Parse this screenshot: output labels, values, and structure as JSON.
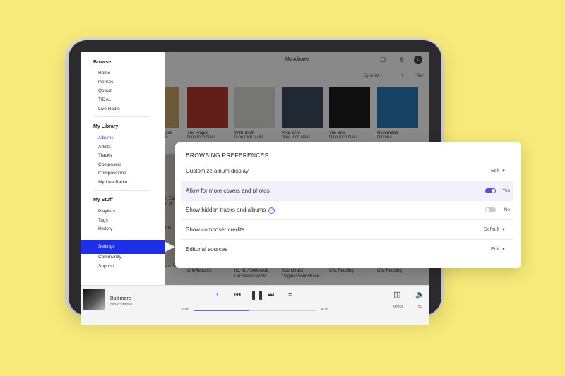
{
  "sidebar": {
    "browse_title": "Browse",
    "browse_items": [
      "Home",
      "Genres",
      "Qobuz",
      "TIDAL",
      "Live Radio"
    ],
    "library_title": "My Library",
    "library_items": [
      "Albums",
      "Artists",
      "Tracks",
      "Composers",
      "Compositions",
      "My Live Radio"
    ],
    "stuff_title": "My Stuff",
    "stuff_items": [
      "Playlists",
      "Tags",
      "History"
    ],
    "settings_label": "Settings",
    "extra_items": [
      "Community",
      "Support"
    ]
  },
  "header": {
    "title": "My Albums",
    "avatar_initial": "L",
    "sort_label": "By artist",
    "filter_label": "Filter"
  },
  "albums": [
    {
      "title": "The Fragile",
      "artist": "Nine Inch Nails",
      "color": "#b23a2a"
    },
    {
      "title": "With Teeth",
      "artist": "Nine Inch Nails",
      "color": "#d8d8d6"
    },
    {
      "title": "Year Zero",
      "artist": "Nine Inch Nails",
      "color": "#3b4c5e"
    },
    {
      "title": "The Slip",
      "artist": "Nine Inch Nails",
      "color": "#1c1c1c"
    },
    {
      "title": "Nevermind",
      "artist": "Nirvana",
      "color": "#2d78b6"
    }
  ],
  "partial_texts": {
    "left_title": "ard",
    "left_sub": "ls",
    "row2_a": "n Earl",
    "row2_b": "n W...",
    "row2_c": "me",
    "row2_d": "ger M"
  },
  "row2": [
    {
      "title": "OneRepublic",
      "artist": ""
    },
    {
      "title": "no. 40 / Serenade",
      "artist": "Orchester der W..."
    },
    {
      "title": "Soundtrack]",
      "artist": "Original Soundtrack"
    },
    {
      "title": "Otis Redding",
      "artist": ""
    },
    {
      "title": "Otis Redding",
      "artist": ""
    }
  ],
  "panel": {
    "title": "BROWSING PREFERENCES",
    "rows": [
      {
        "label": "Customize album display",
        "value": "Edit"
      },
      {
        "label": "Allow for more covers and photos",
        "value": "Yes",
        "toggle": true
      },
      {
        "label": "Show hidden tracks and albums",
        "value": "No",
        "toggle": false
      },
      {
        "label": "Show composer credits",
        "value": "Default"
      },
      {
        "label": "Editorial sources",
        "value": "Edit"
      }
    ]
  },
  "player": {
    "title": "Baltimore",
    "artist": "Nina Simone",
    "elapsed": "2:05",
    "duration": "4:39",
    "progress": 0.45,
    "zone": "Office",
    "volume": "50"
  },
  "icons": {
    "bookmark": "bookmark-icon",
    "search": "search-icon",
    "filter": "filter-icon",
    "prev": "previous-icon",
    "pause": "pause-icon",
    "next": "next-icon",
    "queue": "queue-icon",
    "zone": "speaker-zone-icon",
    "volume": "volume-icon"
  },
  "colors": {
    "accent": "#1f2fe8",
    "toggle_on": "#5a4fc9",
    "background": "#f7ea7a"
  }
}
